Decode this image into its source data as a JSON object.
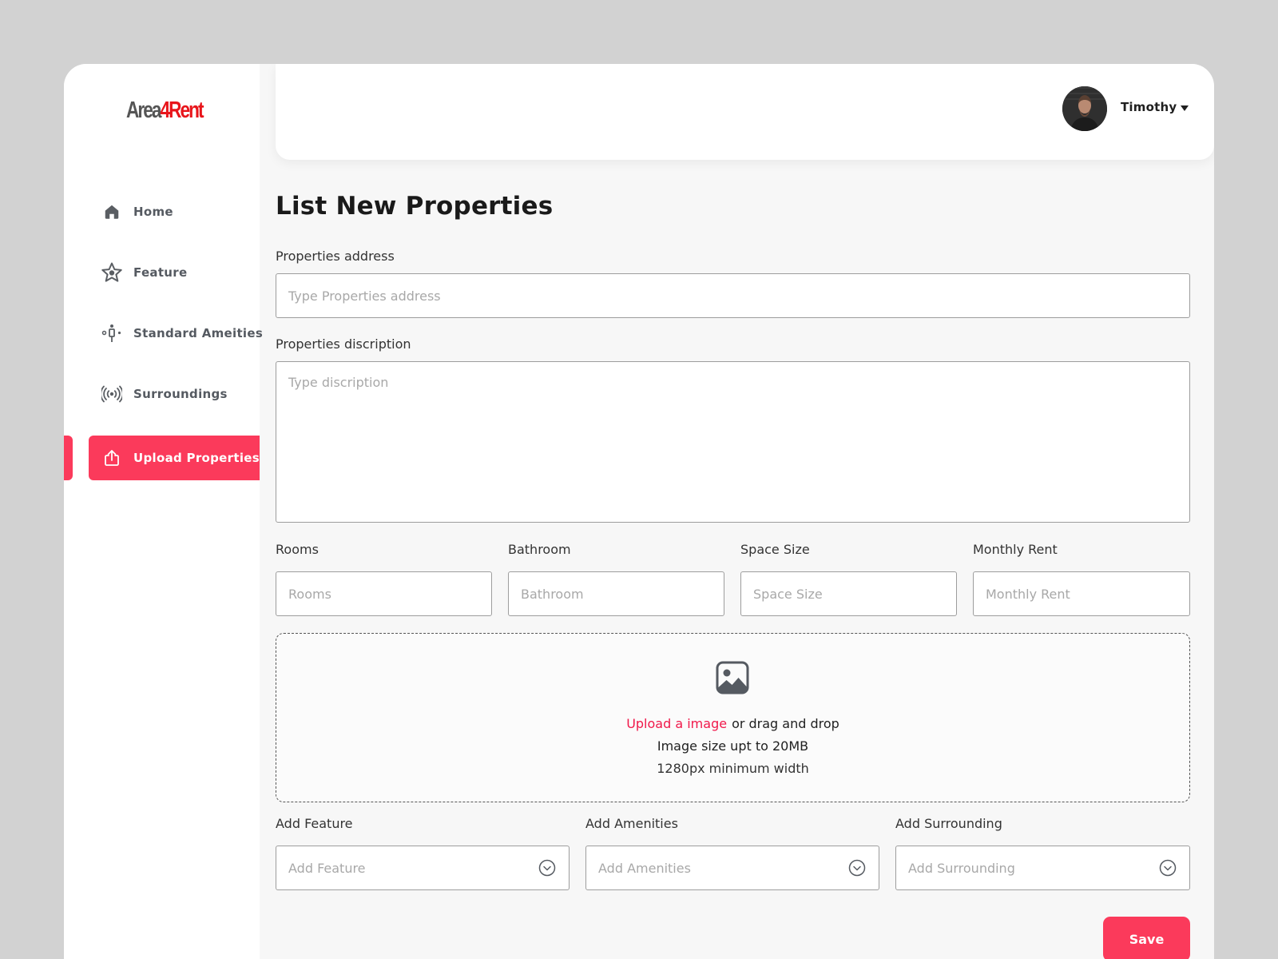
{
  "brand": {
    "part1": "Area",
    "part2": "4Rent"
  },
  "sidebar": {
    "items": [
      {
        "label": "Home",
        "icon": "home-icon"
      },
      {
        "label": "Feature",
        "icon": "star-badge-icon"
      },
      {
        "label": "Standard Ameities",
        "icon": "amenities-icon"
      },
      {
        "label": "Surroundings",
        "icon": "broadcast-icon"
      },
      {
        "label": "Upload Properties",
        "icon": "upload-icon",
        "active": true
      }
    ]
  },
  "header": {
    "user_name": "Timothy"
  },
  "page": {
    "title": "List New Properties"
  },
  "form": {
    "address": {
      "label": "Properties address",
      "placeholder": "Type Properties address"
    },
    "description": {
      "label": "Properties discription",
      "placeholder": "Type discription"
    },
    "rooms": {
      "label": "Rooms",
      "placeholder": "Rooms"
    },
    "bathroom": {
      "label": "Bathroom",
      "placeholder": "Bathroom"
    },
    "space_size": {
      "label": "Space Size",
      "placeholder": "Space Size"
    },
    "monthly_rent": {
      "label": "Monthly Rent",
      "placeholder": "Monthly Rent"
    },
    "upload": {
      "link_text": "Upload a image",
      "rest_text": "or drag and drop",
      "size_text": "Image size upt to 20MB",
      "width_text": "1280px minimum width"
    },
    "feature": {
      "label": "Add Feature",
      "placeholder": "Add Feature"
    },
    "amenities": {
      "label": "Add Amenities",
      "placeholder": "Add Amenities"
    },
    "surrounding": {
      "label": "Add Surrounding",
      "placeholder": "Add Surrounding"
    },
    "save_label": "Save"
  },
  "colors": {
    "accent": "#fb3a5b",
    "brand_red": "#e8151b",
    "link_red": "#f0184a"
  }
}
